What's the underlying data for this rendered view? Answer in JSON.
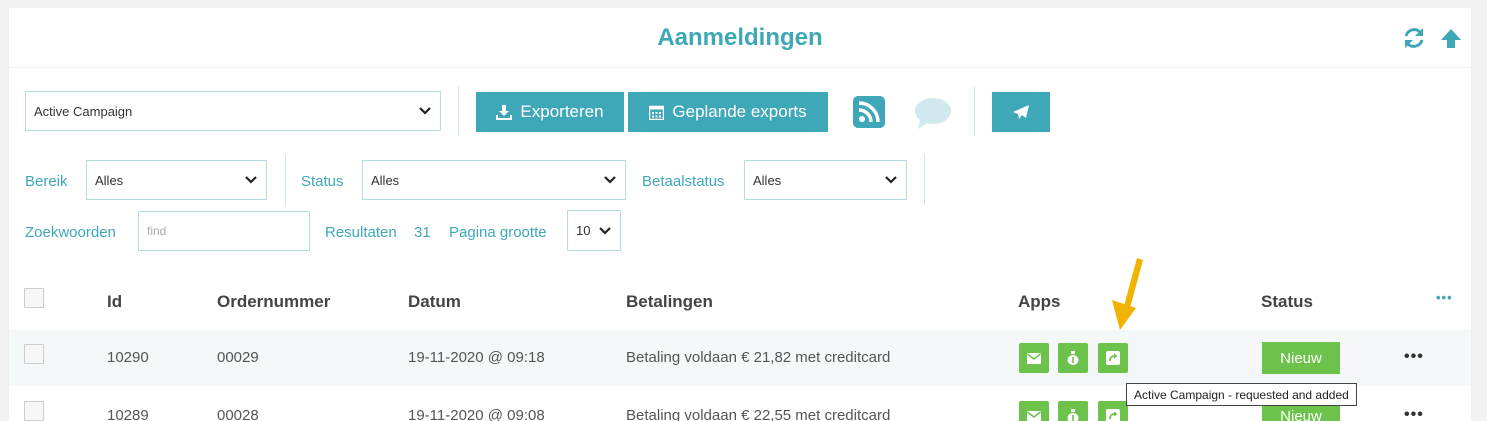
{
  "header": {
    "title": "Aanmeldingen"
  },
  "toolbar": {
    "integration_select": "Active Campaign",
    "export_label": "Exporteren",
    "scheduled_label": "Geplande exports"
  },
  "filters": {
    "range_label": "Bereik",
    "range_value": "Alles",
    "status_label": "Status",
    "status_value": "Alles",
    "payment_status_label": "Betaalstatus",
    "payment_status_value": "Alles",
    "keywords_label": "Zoekwoorden",
    "keywords_placeholder": "find",
    "results_label": "Resultaten",
    "results_count": "31",
    "page_size_label": "Pagina grootte",
    "page_size_value": "10"
  },
  "table": {
    "columns": [
      "Id",
      "Ordernummer",
      "Datum",
      "Betalingen",
      "Apps",
      "Status"
    ],
    "more_columns": "•••",
    "rows": [
      {
        "id": "10290",
        "order": "00029",
        "date": "19-11-2020 @ 09:18",
        "payment": "Betaling voldaan € 21,82 met creditcard",
        "status": "Nieuw",
        "actions": "•••"
      },
      {
        "id": "10289",
        "order": "00028",
        "date": "19-11-2020 @ 09:08",
        "payment": "Betaling voldaan € 22,55 met creditcard",
        "status": "Nieuw",
        "actions": "•••"
      }
    ]
  },
  "tooltip": {
    "text": "Active Campaign - requested and added"
  },
  "colors": {
    "accent": "#3fa8b8",
    "success": "#6cc24a",
    "annotation": "#f0b400"
  },
  "icons": {
    "refresh": "refresh-icon",
    "scroll_top": "arrow-up-icon",
    "download": "download-icon",
    "calendar": "calendar-icon",
    "rss": "rss-icon",
    "chat": "chat-icon",
    "send": "paper-plane-icon",
    "mail": "envelope-icon",
    "money": "money-bag-icon",
    "share": "share-icon"
  }
}
